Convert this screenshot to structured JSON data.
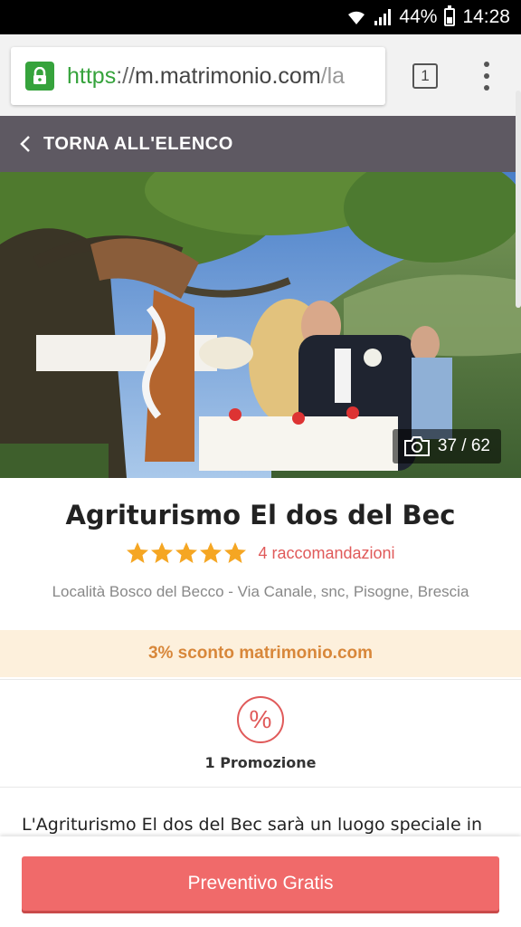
{
  "status_bar": {
    "battery": "44%",
    "battery_level": 0.44,
    "time": "14:28"
  },
  "browser": {
    "url_scheme": "https",
    "url_sep": "://",
    "url_host": "m.matrimonio.com",
    "url_path": "/la",
    "tab_count": "1",
    "secure_color": "#36a33c"
  },
  "nav": {
    "back_label": "TORNA ALL'ELENCO"
  },
  "gallery": {
    "counter": "37 / 62"
  },
  "venue": {
    "name": "Agriturismo El dos del Bec",
    "rating_stars": 5,
    "reviews": "4 raccomandazioni",
    "address": "Località Bosco del Becco - Via Canale, snc, Pisogne, Brescia"
  },
  "discount": {
    "label": "3% sconto matrimonio.com"
  },
  "promotion": {
    "icon": "%",
    "label": "1 Promozione"
  },
  "description": {
    "text": "L'Agriturismo El dos del Bec sarà un luogo speciale in"
  },
  "cta": {
    "label": "Preventivo Gratis"
  },
  "colors": {
    "accent": "#f06a6a",
    "star": "#f5a623",
    "discount_text": "#d8873a",
    "discount_bg": "#fdf0dc",
    "nav_bg": "#5e5962"
  }
}
